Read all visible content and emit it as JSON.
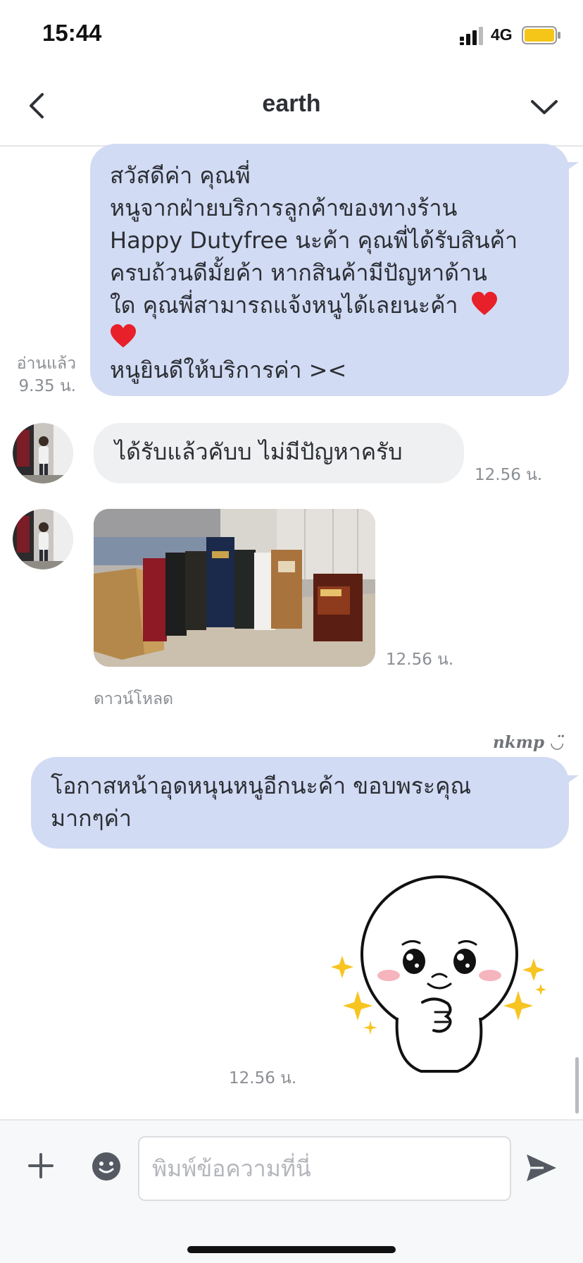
{
  "status_bar": {
    "time": "15:44",
    "network": "4G"
  },
  "header": {
    "title": "earth"
  },
  "messages": {
    "m1": {
      "lines": [
        "สวัสดีค่า คุณพี่",
        "หนูจากฝ่ายบริการลูกค้าของทางร้าน",
        "Happy Dutyfree นะค้า คุณพี่ได้รับสินค้า",
        "ครบถ้วนดีมั้ยค้า หากสินค้ามีปัญหาด้าน",
        "ใด คุณพี่สามารถแจ้งหนูได้เลยนะค้า",
        "หนูยินดีให้บริการค่า ><"
      ],
      "read_label": "อ่านแล้ว",
      "time": "9.35 น."
    },
    "m2": {
      "text": "ได้รับแล้วคับบ ไม่มีปัญหาครับ",
      "time": "12.56 น."
    },
    "m3": {
      "time": "12.56 น.",
      "download_label": "ดาวน์โหลด"
    },
    "m4": {
      "sender_label": "nkmp ◡̈",
      "lines": [
        "โอกาสหน้าอุดหนุนหนูอีกนะค้า ขอบพระคุณ",
        "มากๆค่า"
      ]
    },
    "m5": {
      "time": "12.56 น."
    }
  },
  "input_bar": {
    "placeholder": "พิมพ์ข้อความที่นี่"
  },
  "colors": {
    "outgoing_bubble": "#d2dbf4",
    "incoming_bubble": "#eff0f2",
    "meta_text": "#8b8e94",
    "heart": "#e8202a",
    "sparkle": "#f7c422"
  },
  "icons": [
    "back-icon",
    "chevron-down-icon",
    "plus-icon",
    "smile-icon",
    "send-icon",
    "heart-icon",
    "signal-icon",
    "battery-icon"
  ]
}
